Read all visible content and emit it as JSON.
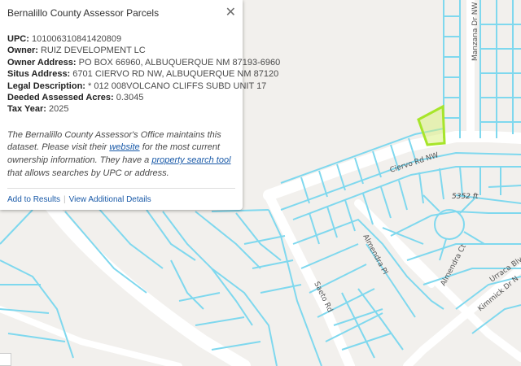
{
  "popup": {
    "title": "Bernalillo County Assessor Parcels",
    "close_symbol": "✕",
    "fields": [
      {
        "label": "UPC:",
        "value": "101006310841420809"
      },
      {
        "label": "Owner:",
        "value": "RUIZ DEVELOPMENT LC"
      },
      {
        "label": "Owner Address:",
        "value": "PO BOX 66960, ALBUQUERQUE NM 87193-6960"
      },
      {
        "label": "Situs Address:",
        "value": "6701 CIERVO RD NW, ALBUQUERQUE NM 87120"
      },
      {
        "label": "Legal Description:",
        "value": "* 012 008VOLCANO CLIFFS SUBD UNIT 17"
      },
      {
        "label": "Deeded Assessed Acres:",
        "value": "0.3045"
      },
      {
        "label": "Tax Year:",
        "value": "2025"
      }
    ],
    "note": {
      "part1": "The Bernalillo County Assessor's Office maintains this dataset. Please visit their ",
      "link1": "website",
      "part2": " for the most current ownership information. They have a ",
      "link2": "property search tool",
      "part3": " that allows searches by UPC or address."
    },
    "actions": {
      "add_to_results": "Add to Results",
      "view_details": "View Additional Details"
    }
  },
  "map": {
    "parcel_line_color": "#7fd8ee",
    "road_color": "#ffffff",
    "selected_fill": "#d8f07a",
    "selected_stroke": "#a7e52a",
    "street_labels": {
      "ciervo": "Ciervo Rd NW",
      "manzana": "Manzana Dr NW",
      "almendra_pl": "Almendra Pl",
      "almendra_ct": "Almendra Ct",
      "saeto": "Saeto Rd",
      "urraca": "Urraca Blvd",
      "kimmick": "Kimmick Dr N"
    },
    "elevation_label": "5352 ft"
  }
}
